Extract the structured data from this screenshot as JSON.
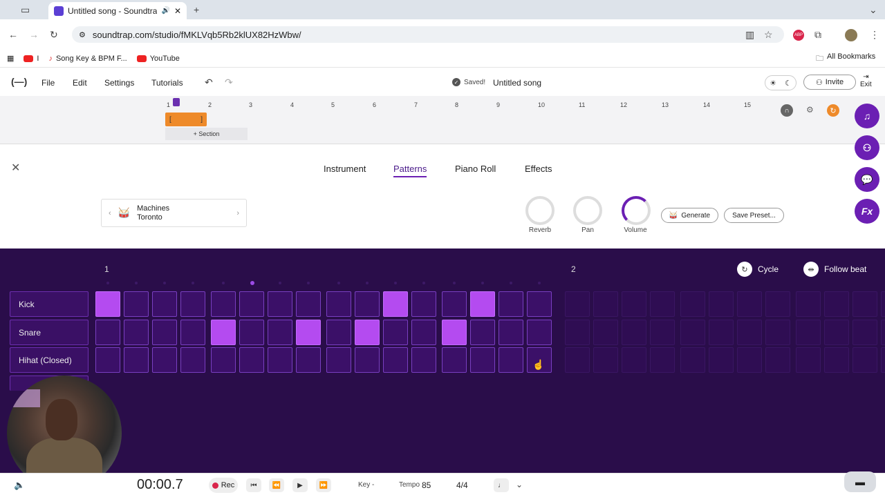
{
  "browser": {
    "tab_title": "Untitled song - Soundtrap",
    "url": "soundtrap.com/studio/fMKLVqb5Rb2klUX82HzWbw/",
    "bookmarks": [
      "I",
      "Song Key & BPM F...",
      "YouTube"
    ],
    "all_bookmarks": "All Bookmarks"
  },
  "app": {
    "logo": "(—)",
    "menu": [
      "File",
      "Edit",
      "Settings",
      "Tutorials"
    ],
    "save_status": "Saved!",
    "song_title": "Untitled song",
    "invite_label": "Invite",
    "exit_label": "Exit"
  },
  "timeline": {
    "bars": [
      "1",
      "2",
      "3",
      "4",
      "5",
      "6",
      "7",
      "8",
      "9",
      "10",
      "11",
      "12",
      "13",
      "14",
      "15"
    ],
    "section_label": "+ Section"
  },
  "panel": {
    "tabs": [
      "Instrument",
      "Patterns",
      "Piano Roll",
      "Effects"
    ],
    "active_tab": "Patterns",
    "kit_category": "Machines",
    "kit_name": "Toronto",
    "knobs": {
      "reverb": "Reverb",
      "pan": "Pan",
      "volume": "Volume"
    },
    "generate_label": "Generate",
    "save_preset_label": "Save Preset..."
  },
  "sequencer": {
    "beat_markers": [
      "1",
      "2"
    ],
    "cycle_label": "Cycle",
    "follow_beat_label": "Follow beat",
    "rows": [
      {
        "name": "Kick",
        "steps": [
          1,
          0,
          0,
          0,
          0,
          0,
          0,
          0,
          0,
          0,
          1,
          0,
          0,
          1,
          0,
          0
        ]
      },
      {
        "name": "Snare",
        "steps": [
          0,
          0,
          0,
          0,
          1,
          0,
          0,
          1,
          0,
          1,
          0,
          0,
          1,
          0,
          0,
          0
        ]
      },
      {
        "name": "Hihat (Closed)",
        "steps": [
          0,
          0,
          0,
          0,
          0,
          0,
          0,
          0,
          0,
          0,
          0,
          0,
          0,
          0,
          0,
          0
        ]
      }
    ]
  },
  "transport": {
    "time": "00:00.7",
    "rec_label": "Rec",
    "key_label": "Key -",
    "tempo_label": "Tempo",
    "tempo_value": "85",
    "time_signature": "4/4"
  },
  "colors": {
    "accent": "#6b1fb3",
    "step_on": "#b44bf0",
    "sequencer_bg": "#2a0d4a",
    "clip": "#ee8a2a",
    "rec": "#d9254b"
  }
}
